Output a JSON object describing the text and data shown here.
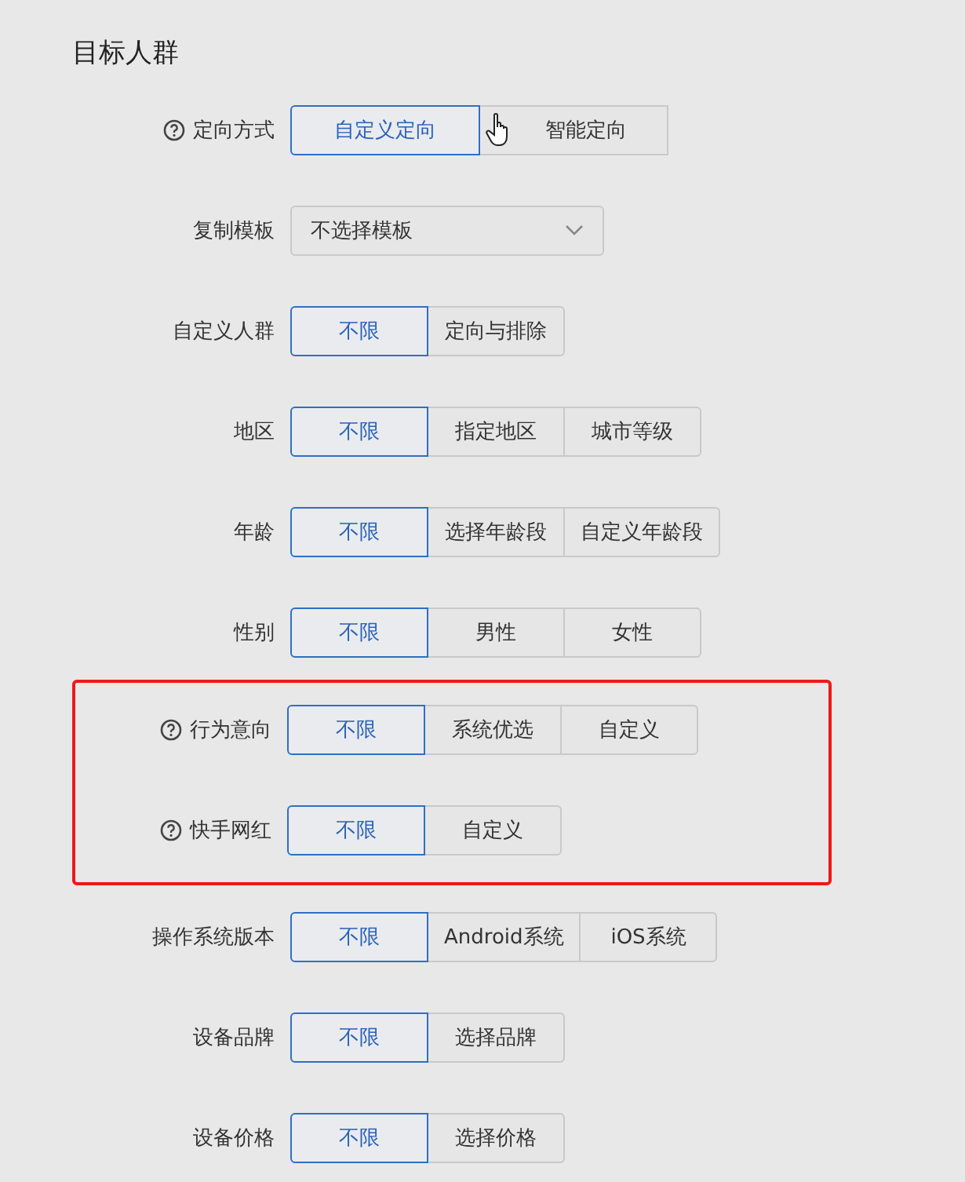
{
  "title": "目标人群",
  "groups": [
    {
      "highlighted": false,
      "rows": [
        {
          "label": "定向方式",
          "help": true,
          "kind": "segmented",
          "options": [
            {
              "label": "自定义定向",
              "selected": true
            },
            {
              "label": "智能定向",
              "selected": false
            }
          ]
        },
        {
          "label": "复制模板",
          "help": false,
          "kind": "select",
          "value": "不选择模板"
        },
        {
          "label": "自定义人群",
          "help": false,
          "kind": "segmented",
          "options": [
            {
              "label": "不限",
              "selected": true
            },
            {
              "label": "定向与排除",
              "selected": false
            }
          ]
        },
        {
          "label": "地区",
          "help": false,
          "kind": "segmented",
          "options": [
            {
              "label": "不限",
              "selected": true
            },
            {
              "label": "指定地区",
              "selected": false
            },
            {
              "label": "城市等级",
              "selected": false
            }
          ]
        },
        {
          "label": "年龄",
          "help": false,
          "kind": "segmented",
          "options": [
            {
              "label": "不限",
              "selected": true
            },
            {
              "label": "选择年龄段",
              "selected": false
            },
            {
              "label": "自定义年龄段",
              "selected": false
            }
          ]
        },
        {
          "label": "性别",
          "help": false,
          "kind": "segmented",
          "options": [
            {
              "label": "不限",
              "selected": true
            },
            {
              "label": "男性",
              "selected": false
            },
            {
              "label": "女性",
              "selected": false
            }
          ]
        }
      ]
    },
    {
      "highlighted": true,
      "rows": [
        {
          "label": "行为意向",
          "help": true,
          "kind": "segmented",
          "options": [
            {
              "label": "不限",
              "selected": true
            },
            {
              "label": "系统优选",
              "selected": false
            },
            {
              "label": "自定义",
              "selected": false
            }
          ]
        },
        {
          "label": "快手网红",
          "help": true,
          "kind": "segmented",
          "options": [
            {
              "label": "不限",
              "selected": true
            },
            {
              "label": "自定义",
              "selected": false
            }
          ]
        }
      ]
    },
    {
      "highlighted": false,
      "rows": [
        {
          "label": "操作系统版本",
          "help": false,
          "kind": "segmented",
          "options": [
            {
              "label": "不限",
              "selected": true
            },
            {
              "label": "Android系统",
              "selected": false
            },
            {
              "label": "iOS系统",
              "selected": false
            }
          ]
        },
        {
          "label": "设备品牌",
          "help": false,
          "kind": "segmented",
          "options": [
            {
              "label": "不限",
              "selected": true
            },
            {
              "label": "选择品牌",
              "selected": false
            }
          ]
        },
        {
          "label": "设备价格",
          "help": false,
          "kind": "segmented",
          "options": [
            {
              "label": "不限",
              "selected": true
            },
            {
              "label": "选择价格",
              "selected": false
            }
          ]
        }
      ]
    }
  ]
}
